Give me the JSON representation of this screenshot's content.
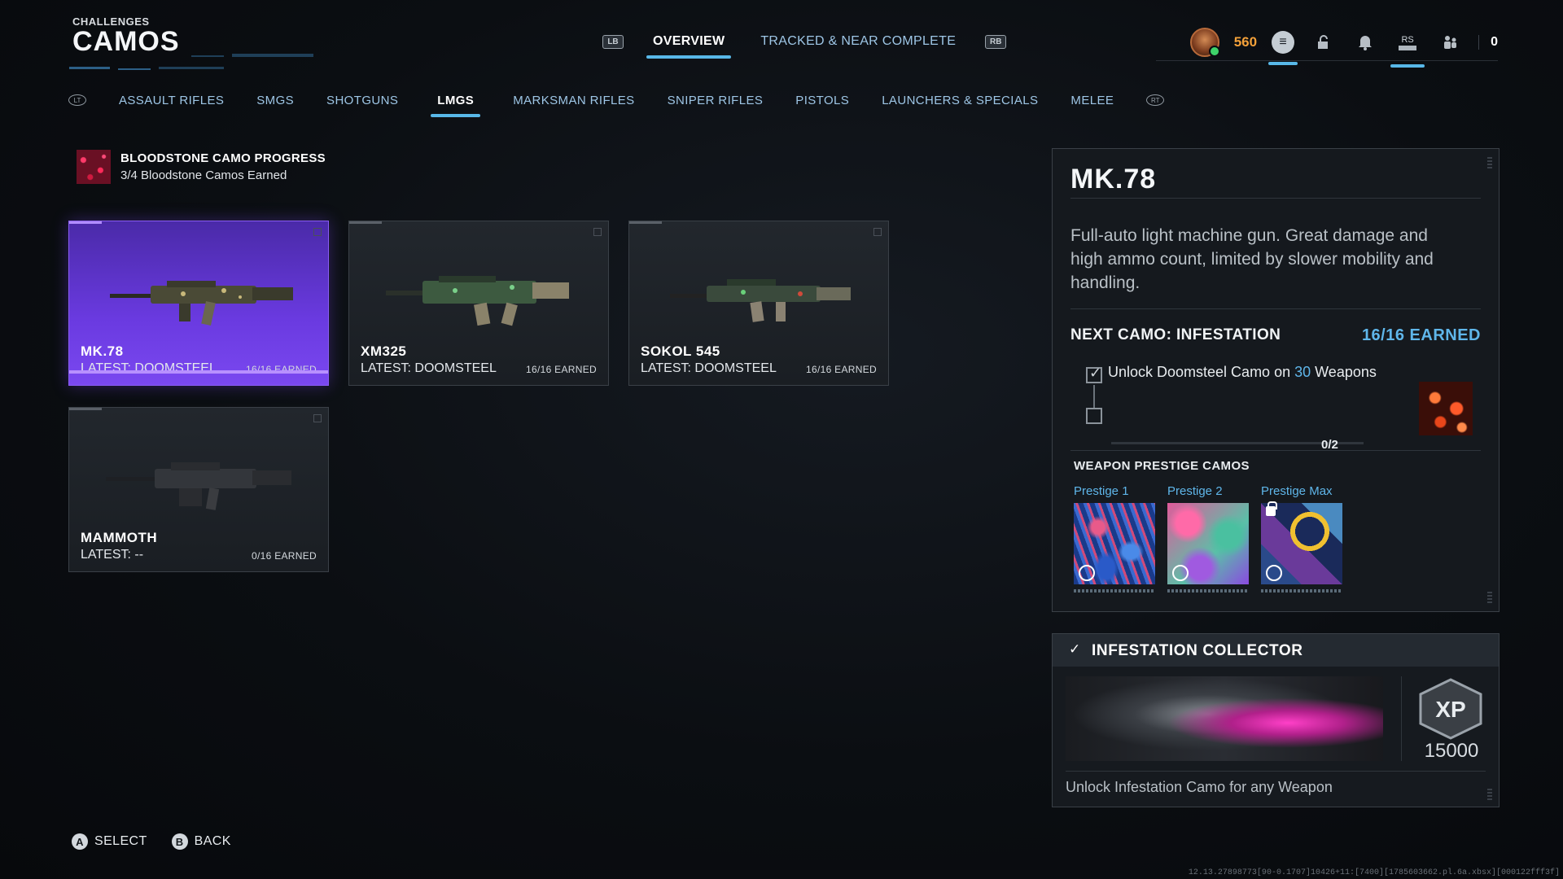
{
  "header": {
    "section": "CHALLENGES",
    "title": "CAMOS"
  },
  "topnav": {
    "lb": "LB",
    "rb": "RB",
    "tabs": [
      {
        "label": "OVERVIEW",
        "active": true
      },
      {
        "label": "TRACKED & NEAR COMPLETE",
        "active": false
      }
    ]
  },
  "topright": {
    "cod_points": "560",
    "rs": "RS",
    "count": "0"
  },
  "categories": {
    "lt": "LT",
    "rt": "RT",
    "items": [
      {
        "label": "ASSAULT RIFLES",
        "active": false
      },
      {
        "label": "SMGS",
        "active": false
      },
      {
        "label": "SHOTGUNS",
        "active": false
      },
      {
        "label": "LMGS",
        "active": true
      },
      {
        "label": "MARKSMAN RIFLES",
        "active": false
      },
      {
        "label": "SNIPER RIFLES",
        "active": false
      },
      {
        "label": "PISTOLS",
        "active": false
      },
      {
        "label": "LAUNCHERS & SPECIALS",
        "active": false
      },
      {
        "label": "MELEE",
        "active": false
      }
    ]
  },
  "progress": {
    "title": "BLOODSTONE CAMO PROGRESS",
    "subtitle": "3/4 Bloodstone Camos Earned"
  },
  "weapons": [
    {
      "name": "MK.78",
      "latest": "LATEST: DOOMSTEEL",
      "earned": "16/16 EARNED",
      "selected": true
    },
    {
      "name": "XM325",
      "latest": "LATEST: DOOMSTEEL",
      "earned": "16/16 EARNED",
      "selected": false
    },
    {
      "name": "SOKOL 545",
      "latest": "LATEST: DOOMSTEEL",
      "earned": "16/16 EARNED",
      "selected": false
    },
    {
      "name": "MAMMOTH",
      "latest": "LATEST: --",
      "earned": "0/16 EARNED",
      "selected": false
    }
  ],
  "detail": {
    "title": "MK.78",
    "description": "Full-auto light machine gun. Great damage and high ammo count, limited by slower mobility and handling.",
    "next_camo": "NEXT CAMO: INFESTATION",
    "earned": "16/16 EARNED",
    "requirement_prefix": "Unlock Doomsteel Camo on ",
    "requirement_num": "30",
    "requirement_suffix": " Weapons",
    "requirement_done": true,
    "second_done": false,
    "progress_text": "0/2",
    "progress_fraction": 0,
    "prestige_title": "WEAPON PRESTIGE CAMOS",
    "prestige": [
      {
        "label": "Prestige 1",
        "locked": false
      },
      {
        "label": "Prestige 2",
        "locked": false
      },
      {
        "label": "Prestige Max",
        "locked": true
      }
    ]
  },
  "collector": {
    "title": "INFESTATION COLLECTOR",
    "xp_badge": "XP",
    "xp": "15000",
    "description": "Unlock Infestation Camo for any Weapon"
  },
  "footer": {
    "select_glyph": "A",
    "select": "SELECT",
    "back_glyph": "B",
    "back": "BACK"
  },
  "build": "12.13.27898773[90-0.1707]10426+11:[7400][1785603662.pl.6a.xbsx][000122fff3f]",
  "colors": {
    "accent": "#58b8e8",
    "selected_card": "#6a3ae0",
    "cod_points": "#f4a13a",
    "earned_blue": "#5fb6ea"
  }
}
